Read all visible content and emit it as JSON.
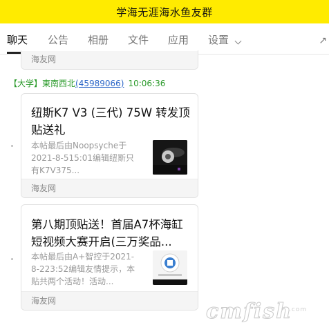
{
  "window": {
    "title": "学海无涯海水鱼友群"
  },
  "tabs": [
    {
      "label": "聊天",
      "active": true
    },
    {
      "label": "公告"
    },
    {
      "label": "相册"
    },
    {
      "label": "文件"
    },
    {
      "label": "应用"
    },
    {
      "label": "设置"
    }
  ],
  "messages": [
    {
      "footer": "海友网"
    },
    {
      "sender_tag": "【大学】",
      "sender_name": "東南西北",
      "sender_id": "(45989066)",
      "time": "10:06:36",
      "card": {
        "title": "纽斯K7 V3 (三代) 75W 转发顶贴送礼",
        "desc": "本帖最后由Noopsyche于2021-8-515:01编辑纽斯只有K7V375...",
        "footer": "海友网"
      }
    },
    {
      "card": {
        "title": "第八期顶贴送！首届A7杯海缸短视频大赛开启(三万奖品...",
        "desc": "本帖最后由A+智控于2021-8-223:52编辑友情提示，本贴共两个活动！活动...",
        "footer": "海友网"
      }
    }
  ],
  "watermark": {
    "text": "cmfish",
    "sub": ".com"
  },
  "colors": {
    "titlebar": "#ffeb00",
    "link": "#2b66c8",
    "sender": "#2a9a2a"
  }
}
